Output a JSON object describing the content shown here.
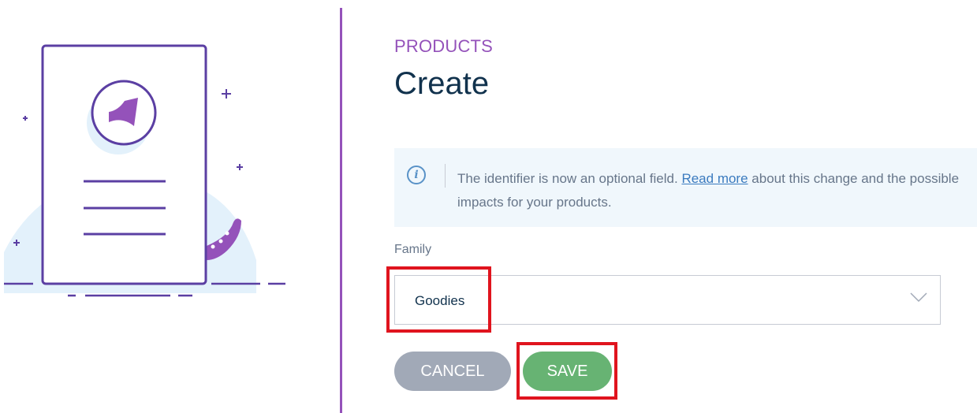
{
  "header": {
    "section_label": "PRODUCTS",
    "title": "Create"
  },
  "info_banner": {
    "icon": "info-icon",
    "text_before_link": "The identifier is now an optional field. ",
    "link_text": "Read more",
    "text_after_link": " about this change and the possible impacts for your products."
  },
  "form": {
    "family_label": "Family",
    "family_value": "Goodies",
    "cancel_label": "CANCEL",
    "save_label": "SAVE"
  },
  "colors": {
    "brand_purple": "#9452ba",
    "title": "#11324d",
    "info_background": "#f0f7fc",
    "link": "#3b7bbf",
    "cancel_button": "#a1a9b7",
    "save_button": "#67b373",
    "highlight": "#e0141e"
  }
}
